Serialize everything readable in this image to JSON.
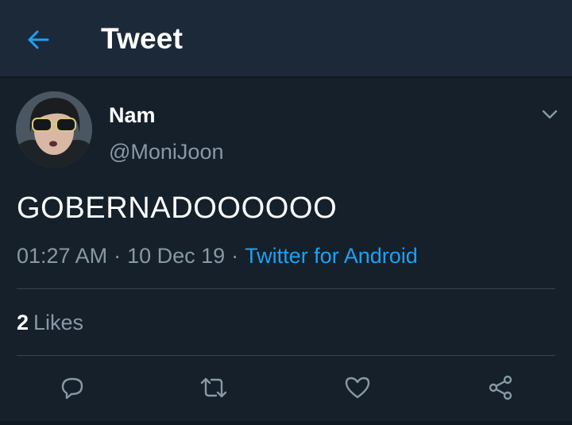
{
  "header": {
    "title": "Tweet",
    "back_icon": "arrow-left-icon"
  },
  "tweet": {
    "author": {
      "name": "Nam",
      "handle": "@MoniJoon"
    },
    "menu_icon": "chevron-down-icon",
    "text": "GOBERNADOOOOOO",
    "time": "01:27 AM",
    "date": "10 Dec 19",
    "separator": "·",
    "source": "Twitter for Android",
    "likes": {
      "count": "2",
      "label": "Likes"
    }
  },
  "actions": [
    {
      "name": "reply",
      "icon": "reply-icon"
    },
    {
      "name": "retweet",
      "icon": "retweet-icon"
    },
    {
      "name": "like",
      "icon": "heart-icon"
    },
    {
      "name": "share",
      "icon": "share-icon"
    }
  ],
  "colors": {
    "background": "#15202b",
    "header_background": "#1c2938",
    "accent": "#1da1f2",
    "secondary_text": "#8899a6",
    "divider": "#38444d"
  }
}
